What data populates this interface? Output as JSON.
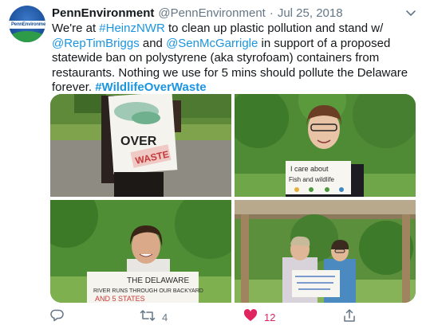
{
  "tweet": {
    "author_name": "PennEnvironment",
    "author_handle": "@PennEnvironment",
    "separator": "·",
    "date": "Jul 25, 2018",
    "avatar_logo_text": "PennEnvironment",
    "text_segments": [
      {
        "text": "We're at ",
        "type": "text"
      },
      {
        "text": "#HeinzNWR",
        "type": "link"
      },
      {
        "text": " to clean up plastic pollution and stand w/ ",
        "type": "text"
      },
      {
        "text": "@RepTimBriggs",
        "type": "link"
      },
      {
        "text": " and ",
        "type": "text"
      },
      {
        "text": "@SenMcGarrigle",
        "type": "link"
      },
      {
        "text": " in support of a proposed statewide ban on polystyrene (aka styrofoam) containers from restaurants. Nothing we use for 5 mins should pollute the Delaware forever. ",
        "type": "text"
      },
      {
        "text": "#WildlifeOverWaste",
        "type": "tag"
      }
    ],
    "photos": [
      {
        "sign_text": [
          "OVER",
          "WASTE"
        ]
      },
      {
        "sign_text": [
          "I care about",
          "Fish and wildlife"
        ]
      },
      {
        "sign_text": [
          "THE DELAWARE",
          "RIVER RUNS THROUGH OUR BACKYARD",
          "AND 5 STATES"
        ]
      },
      {
        "sign_text": []
      }
    ],
    "actions": {
      "reply_count": "",
      "retweet_count": "4",
      "like_count": "12",
      "share_count": ""
    },
    "colors": {
      "link": "#1b95e0",
      "like": "#e0245e",
      "muted": "#657786"
    },
    "icons": [
      "caret-down-icon",
      "reply-icon",
      "retweet-icon",
      "heart-icon",
      "share-icon"
    ]
  }
}
